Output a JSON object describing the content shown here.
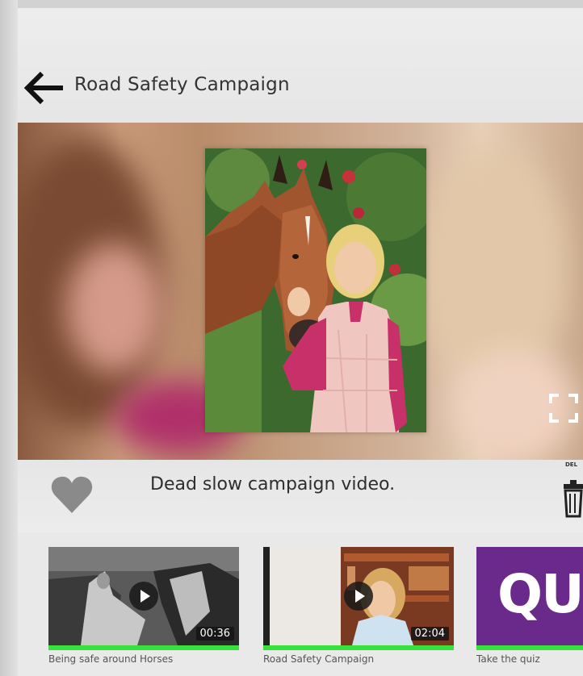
{
  "header": {
    "title": "Road Safety Campaign",
    "back_icon": "arrow-left-icon"
  },
  "player": {
    "fullscreen_icon": "fullscreen-icon"
  },
  "actions": {
    "caption": "Dead slow campaign video.",
    "favorite_icon": "heart-icon",
    "delete_label": "DEL",
    "delete_icon": "trash-icon"
  },
  "thumbnails": [
    {
      "label": "Being safe around Horses",
      "duration": "00:36"
    },
    {
      "label": "Road Safety Campaign",
      "duration": "02:04"
    },
    {
      "label": "Take the quiz",
      "logo_text": "QU"
    }
  ],
  "colors": {
    "progress_bar": "#39e23a",
    "quiz_purple": "#6a2a8c"
  }
}
